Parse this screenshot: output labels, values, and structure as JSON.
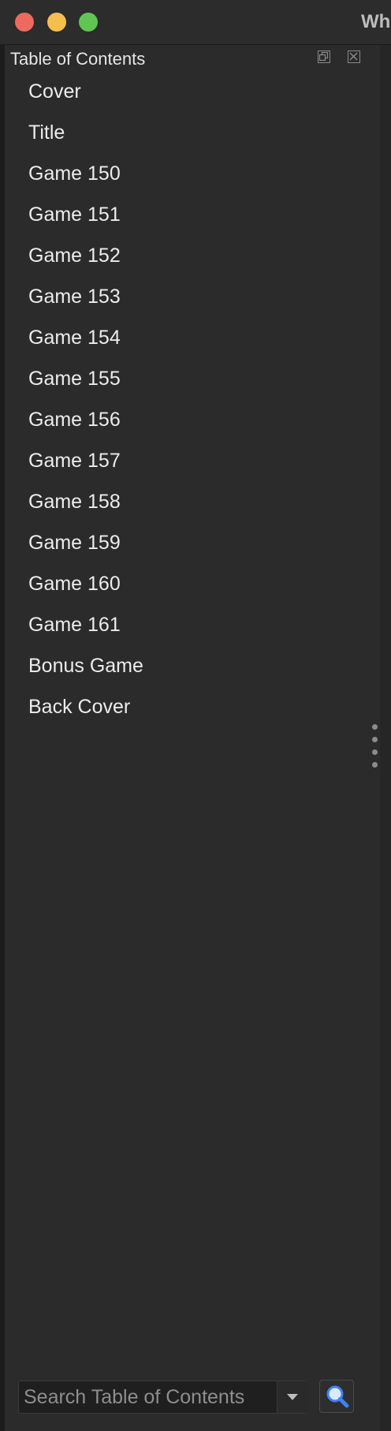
{
  "window": {
    "title": "Wh",
    "controls": {
      "close_color": "#ed6a5e",
      "minimize_color": "#f5bf4f",
      "maximize_color": "#61c554"
    }
  },
  "panel": {
    "title": "Table of Contents",
    "float_icon": "float-panel-icon",
    "close_icon": "close-panel-icon"
  },
  "toc": {
    "items": [
      {
        "label": "Cover"
      },
      {
        "label": "Title"
      },
      {
        "label": "Game 150"
      },
      {
        "label": "Game 151"
      },
      {
        "label": "Game 152"
      },
      {
        "label": "Game 153"
      },
      {
        "label": "Game 154"
      },
      {
        "label": "Game 155"
      },
      {
        "label": "Game 156"
      },
      {
        "label": "Game 157"
      },
      {
        "label": "Game 158"
      },
      {
        "label": "Game 159"
      },
      {
        "label": "Game 160"
      },
      {
        "label": "Game 161"
      },
      {
        "label": "Bonus Game"
      },
      {
        "label": "Back Cover"
      }
    ]
  },
  "search": {
    "placeholder": "Search Table of Contents",
    "value": "",
    "dropdown_icon": "chevron-down-icon",
    "button_icon": "search-icon",
    "accent": "#3b82f6"
  }
}
